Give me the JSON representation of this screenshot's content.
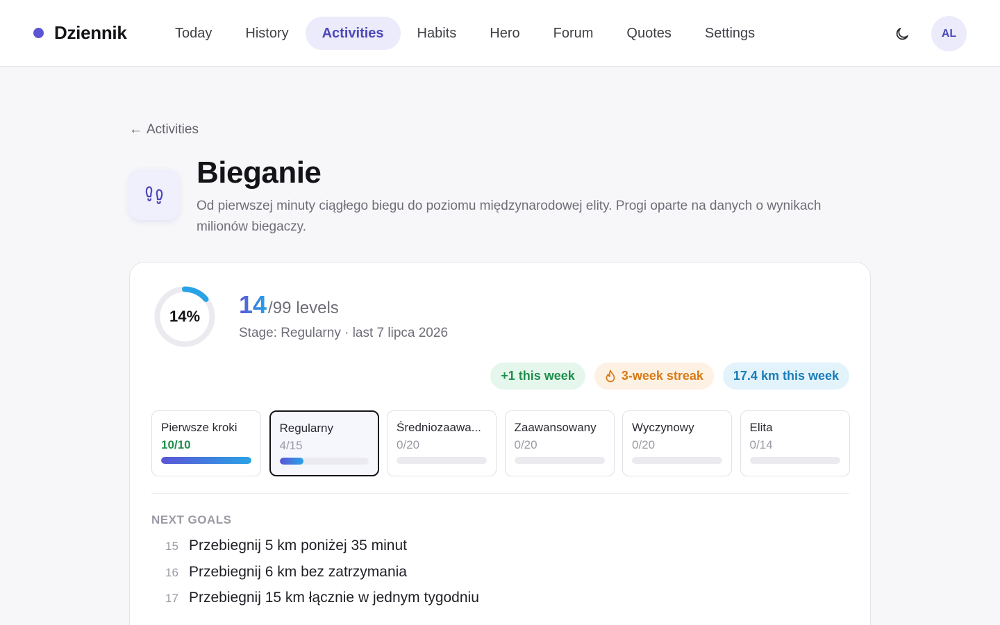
{
  "header": {
    "brand": "Dziennik",
    "nav": [
      "Today",
      "History",
      "Activities",
      "Habits",
      "Hero",
      "Forum",
      "Quotes",
      "Settings"
    ],
    "active_nav": "Activities",
    "avatar_initials": "AL",
    "theme_icon": "moon-icon"
  },
  "page": {
    "back_label": "Activities",
    "back_arrow": "←",
    "activity_icon": "footprints-icon",
    "title": "Bieganie",
    "description": "Od pierwszej minuty ciągłego biegu do poziomu międzynarodowej elity. Progi oparte na danych o wynikach milionów biegaczy."
  },
  "summary": {
    "percent_label": "14%",
    "percent_value": 0.14,
    "levels_current": "14",
    "levels_total": "/99",
    "levels_suffix": "levels",
    "stage_line": "Stage: Regularny · last 7 lipca 2026"
  },
  "badges": [
    {
      "label": "+1 this week",
      "tone": "green"
    },
    {
      "label": "3-week streak",
      "tone": "orange",
      "icon": "flame-icon"
    },
    {
      "label": "17.4 km this week",
      "tone": "blue"
    }
  ],
  "stages": [
    {
      "name": "Pierwsze kroki",
      "count": "10/10",
      "done": 10,
      "total": 10,
      "status": "complete"
    },
    {
      "name": "Regularny",
      "count": "4/15",
      "done": 4,
      "total": 15,
      "status": "current"
    },
    {
      "name": "Średniozaawa...",
      "count": "0/20",
      "done": 0,
      "total": 20,
      "status": "locked"
    },
    {
      "name": "Zaawansowany",
      "count": "0/20",
      "done": 0,
      "total": 20,
      "status": "locked"
    },
    {
      "name": "Wyczynowy",
      "count": "0/20",
      "done": 0,
      "total": 20,
      "status": "locked"
    },
    {
      "name": "Elita",
      "count": "0/14",
      "done": 0,
      "total": 14,
      "status": "locked"
    }
  ],
  "next_goals": {
    "heading": "NEXT GOALS",
    "items": [
      {
        "num": "15",
        "text": "Przebiegnij 5 km poniżej 35 minut"
      },
      {
        "num": "16",
        "text": "Przebiegnij 6 km bez zatrzymania"
      },
      {
        "num": "17",
        "text": "Przebiegnij 15 km łącznie w jednym tygodniu"
      }
    ]
  },
  "colors": {
    "accent": "#5b55d6",
    "accent_end": "#29a3e6",
    "success": "#1f8f4e",
    "warning": "#d77a16",
    "info": "#1a7cb8"
  }
}
